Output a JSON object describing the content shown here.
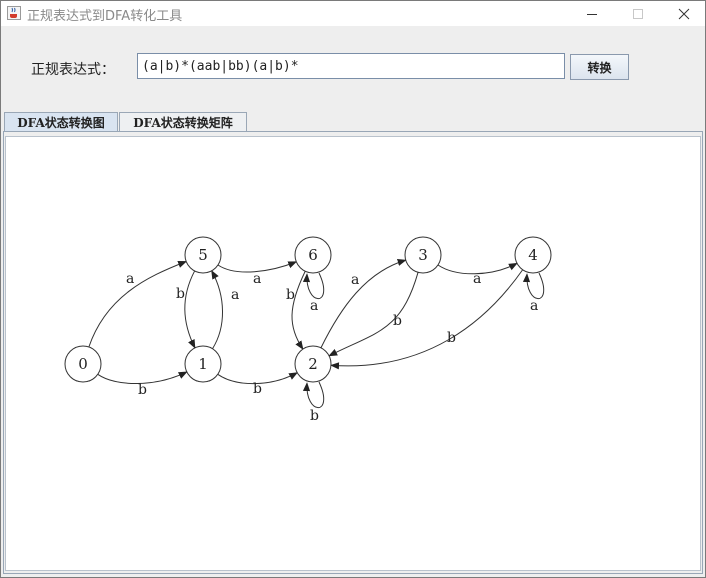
{
  "window": {
    "title": "正规表达式到DFA转化工具",
    "icon": "java-cup-icon",
    "controls": [
      "minimize-icon",
      "maximize-icon",
      "close-icon"
    ]
  },
  "form": {
    "regex_label": "正规表达式：",
    "regex_value": "(a|b)*(aab|bb)(a|b)*",
    "convert_label": "转换"
  },
  "tabs": [
    {
      "label": "DFA状态转换图",
      "active": true
    },
    {
      "label": "DFA状态转换矩阵",
      "active": false
    }
  ],
  "graph": {
    "states": [
      "0",
      "1",
      "2",
      "3",
      "4",
      "5",
      "6"
    ],
    "transitions": [
      {
        "from": "0",
        "to": "5",
        "label": "a"
      },
      {
        "from": "0",
        "to": "1",
        "label": "b"
      },
      {
        "from": "5",
        "to": "1",
        "label": "b"
      },
      {
        "from": "1",
        "to": "5",
        "label": "a"
      },
      {
        "from": "5",
        "to": "6",
        "label": "a"
      },
      {
        "from": "1",
        "to": "2",
        "label": "b"
      },
      {
        "from": "6",
        "to": "6",
        "label": "a"
      },
      {
        "from": "6",
        "to": "2",
        "label": "b"
      },
      {
        "from": "2",
        "to": "2",
        "label": "b"
      },
      {
        "from": "2",
        "to": "3",
        "label": "a"
      },
      {
        "from": "3",
        "to": "2",
        "label": "b"
      },
      {
        "from": "3",
        "to": "4",
        "label": "a"
      },
      {
        "from": "4",
        "to": "4",
        "label": "a"
      },
      {
        "from": "4",
        "to": "2",
        "label": "b"
      }
    ]
  }
}
